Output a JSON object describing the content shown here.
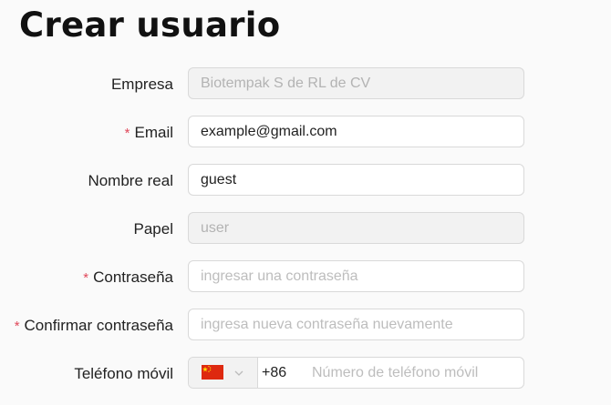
{
  "page": {
    "title": "Crear usuario"
  },
  "form": {
    "empresa": {
      "label": "Empresa",
      "value": "Biotempak S de RL de CV"
    },
    "email": {
      "label": "Email",
      "value": "example@gmail.com"
    },
    "nombre_real": {
      "label": "Nombre real",
      "value": "guest"
    },
    "papel": {
      "label": "Papel",
      "value": "user"
    },
    "contrasena": {
      "label": "Contraseña",
      "placeholder": "ingresar una contraseña"
    },
    "confirmar": {
      "label": "Confirmar contraseña",
      "placeholder": "ingresa nueva contraseña nuevamente"
    },
    "telefono": {
      "label": "Teléfono móvil",
      "country_icon": "china-flag-icon",
      "prefix": "+86",
      "placeholder": "Número de teléfono móvil"
    },
    "required_marker": "*"
  },
  "colors": {
    "required": "#e0485a",
    "disabled_bg": "#f2f2f2",
    "border": "#d9d9d9"
  }
}
